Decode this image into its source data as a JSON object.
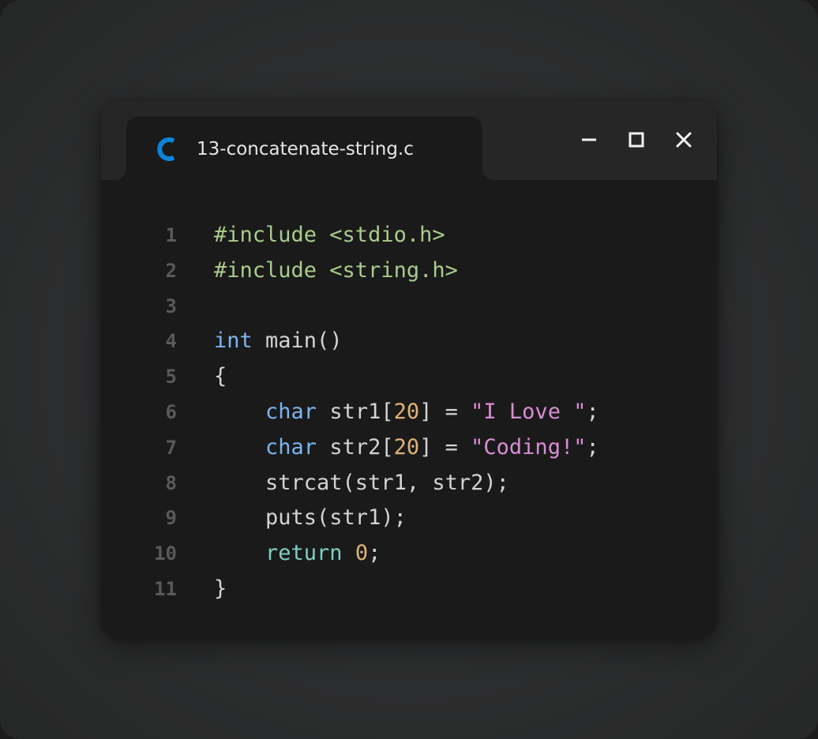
{
  "window": {
    "tab_title": "13-concatenate-string.c",
    "tab_icon": "c-language-icon",
    "controls": [
      "minimize-icon",
      "maximize-icon",
      "close-icon"
    ]
  },
  "colors": {
    "accent_icon": "#0a84d6",
    "include": "#a8cc8c",
    "keyword": "#7ab5f0",
    "number": "#e0b378",
    "string": "#d98ed4",
    "return": "#7fcfc4",
    "text": "#d4d4d4",
    "line_number": "#5a5a5a"
  },
  "code": {
    "line_numbers": [
      "1",
      "2",
      "3",
      "4",
      "5",
      "6",
      "7",
      "8",
      "9",
      "10",
      "11"
    ],
    "lines": [
      [
        {
          "c": "inc",
          "t": "#include <stdio.h>"
        }
      ],
      [
        {
          "c": "inc",
          "t": "#include <string.h>"
        }
      ],
      [],
      [
        {
          "c": "kw",
          "t": "int"
        },
        {
          "c": "plain",
          "t": " main()"
        }
      ],
      [
        {
          "c": "plain",
          "t": "{"
        }
      ],
      [
        {
          "c": "plain",
          "t": "    "
        },
        {
          "c": "kw",
          "t": "char"
        },
        {
          "c": "plain",
          "t": " str1["
        },
        {
          "c": "num",
          "t": "20"
        },
        {
          "c": "plain",
          "t": "] = "
        },
        {
          "c": "str",
          "t": "\"I Love \""
        },
        {
          "c": "plain",
          "t": ";"
        }
      ],
      [
        {
          "c": "plain",
          "t": "    "
        },
        {
          "c": "kw",
          "t": "char"
        },
        {
          "c": "plain",
          "t": " str2["
        },
        {
          "c": "num",
          "t": "20"
        },
        {
          "c": "plain",
          "t": "] = "
        },
        {
          "c": "str",
          "t": "\"Coding!\""
        },
        {
          "c": "plain",
          "t": ";"
        }
      ],
      [
        {
          "c": "plain",
          "t": "    strcat(str1, str2);"
        }
      ],
      [
        {
          "c": "plain",
          "t": "    puts(str1);"
        }
      ],
      [
        {
          "c": "plain",
          "t": "    "
        },
        {
          "c": "ret",
          "t": "return"
        },
        {
          "c": "plain",
          "t": " "
        },
        {
          "c": "num",
          "t": "0"
        },
        {
          "c": "plain",
          "t": ";"
        }
      ],
      [
        {
          "c": "plain",
          "t": "}"
        }
      ]
    ]
  }
}
